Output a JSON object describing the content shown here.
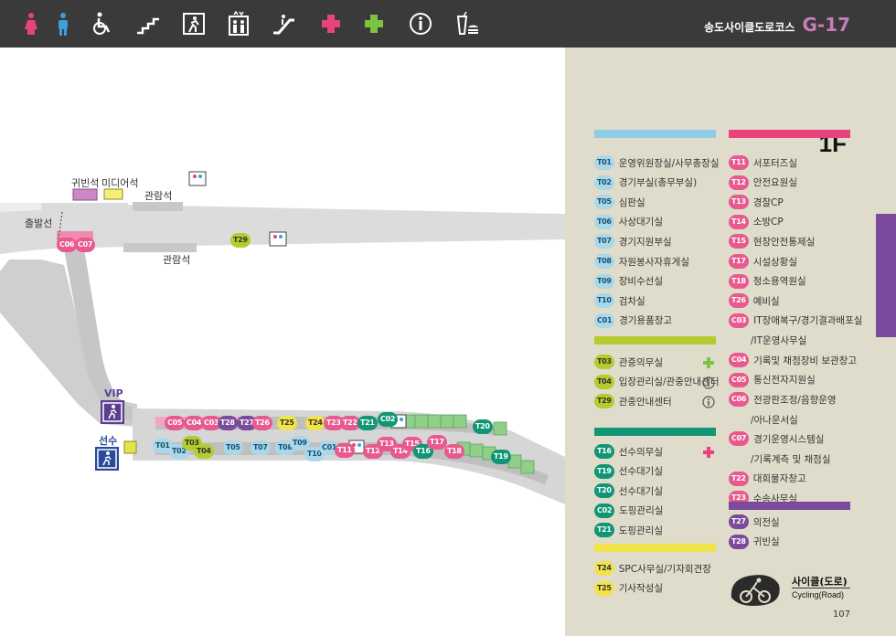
{
  "header": {
    "title": "송도사이클도로코스",
    "code": "G-17",
    "icons": [
      {
        "name": "female-restroom-icon",
        "color": "#e8437d"
      },
      {
        "name": "male-restroom-icon",
        "color": "#3aa0d8"
      },
      {
        "name": "wheelchair-icon",
        "color": "#ffffff"
      },
      {
        "name": "stairs-icon",
        "color": "#ffffff"
      },
      {
        "name": "emergency-exit-icon",
        "color": "#ffffff"
      },
      {
        "name": "elevator-icon",
        "color": "#ffffff"
      },
      {
        "name": "escalator-icon",
        "color": "#ffffff"
      },
      {
        "name": "first-aid-pink-icon",
        "color": "#e8437d"
      },
      {
        "name": "first-aid-green-icon",
        "color": "#7dc243"
      },
      {
        "name": "information-icon",
        "color": "#ffffff"
      },
      {
        "name": "food-drink-icon",
        "color": "#ffffff"
      }
    ]
  },
  "map": {
    "labels": {
      "vip_box": "귀빈석",
      "media_box": "미디어석",
      "stands_top": "관람석",
      "stands_bottom": "관람석",
      "start_line": "출발선",
      "vip": "VIP",
      "athletes": "선수"
    },
    "markers": [
      {
        "code": "C06",
        "color": "pink"
      },
      {
        "code": "C07",
        "color": "pink"
      },
      {
        "code": "T29",
        "color": "lime"
      },
      {
        "code": "C05",
        "color": "pink"
      },
      {
        "code": "C04",
        "color": "pink"
      },
      {
        "code": "C03",
        "color": "pink"
      },
      {
        "code": "T28",
        "color": "purple"
      },
      {
        "code": "T27",
        "color": "purple"
      },
      {
        "code": "T26",
        "color": "pink"
      },
      {
        "code": "T25",
        "color": "yellow"
      },
      {
        "code": "T24",
        "color": "yellow"
      },
      {
        "code": "T23",
        "color": "pink"
      },
      {
        "code": "T22",
        "color": "pink"
      },
      {
        "code": "T21",
        "color": "green"
      },
      {
        "code": "C02",
        "color": "green"
      },
      {
        "code": "T20",
        "color": "green"
      },
      {
        "code": "T01",
        "color": "blue"
      },
      {
        "code": "T02",
        "color": "blue"
      },
      {
        "code": "T03",
        "color": "lime"
      },
      {
        "code": "T04",
        "color": "lime"
      },
      {
        "code": "T05",
        "color": "blue"
      },
      {
        "code": "T07",
        "color": "blue"
      },
      {
        "code": "T08",
        "color": "blue"
      },
      {
        "code": "T09",
        "color": "blue"
      },
      {
        "code": "T10",
        "color": "blue"
      },
      {
        "code": "C01",
        "color": "blue"
      },
      {
        "code": "T11",
        "color": "pink"
      },
      {
        "code": "T12",
        "color": "pink"
      },
      {
        "code": "T13",
        "color": "pink"
      },
      {
        "code": "T14",
        "color": "pink"
      },
      {
        "code": "T15",
        "color": "pink"
      },
      {
        "code": "T16",
        "color": "green"
      },
      {
        "code": "T17",
        "color": "pink"
      },
      {
        "code": "T18",
        "color": "pink"
      },
      {
        "code": "T19",
        "color": "green"
      }
    ]
  },
  "legend": {
    "floor": "1F",
    "colors": {
      "blue": "#8fcde6",
      "pink": "#e8437d",
      "lime": "#b6cc2e",
      "green": "#109675",
      "yellow": "#f1e34a",
      "purple": "#7a4a9c"
    },
    "left_blue": [
      {
        "code": "T01",
        "label": "운영위원장실/사무총장실"
      },
      {
        "code": "T02",
        "label": "경기부실(총무부실)"
      },
      {
        "code": "T05",
        "label": "심판실"
      },
      {
        "code": "T06",
        "label": "사상대기실"
      },
      {
        "code": "T07",
        "label": "경기지원부실"
      },
      {
        "code": "T08",
        "label": "자원봉사자휴게실"
      },
      {
        "code": "T09",
        "label": "장비수선실"
      },
      {
        "code": "T10",
        "label": "검차실"
      },
      {
        "code": "C01",
        "label": "경기용품창고"
      }
    ],
    "left_lime": [
      {
        "code": "T03",
        "label": "관중의무실",
        "icon": "first-aid-green-icon"
      },
      {
        "code": "T04",
        "label": "입장관리실/관중안내센터",
        "icon": "information-icon"
      },
      {
        "code": "T29",
        "label": "관중안내센터",
        "icon": "information-icon"
      }
    ],
    "left_green": [
      {
        "code": "T16",
        "label": "선수의무실",
        "icon": "first-aid-pink-icon"
      },
      {
        "code": "T19",
        "label": "선수대기실"
      },
      {
        "code": "T20",
        "label": "선수대기실"
      },
      {
        "code": "C02",
        "label": "도핑관리실"
      },
      {
        "code": "T21",
        "label": "도핑관리실"
      }
    ],
    "left_yellow": [
      {
        "code": "T24",
        "label": "SPC사무실/기자회견장"
      },
      {
        "code": "T25",
        "label": "기사작성실"
      }
    ],
    "right_pink": [
      {
        "code": "T11",
        "label": "서포터즈실"
      },
      {
        "code": "T12",
        "label": "안전요원실"
      },
      {
        "code": "T13",
        "label": "경찰CP"
      },
      {
        "code": "T14",
        "label": "소방CP"
      },
      {
        "code": "T15",
        "label": "현장안전통제실"
      },
      {
        "code": "T17",
        "label": "시설상황실"
      },
      {
        "code": "T18",
        "label": "청소용역원실"
      },
      {
        "code": "T26",
        "label": "예비실"
      },
      {
        "code": "C03",
        "label": "IT장애복구/경기결과배포실",
        "cont": "/IT운영사무실"
      },
      {
        "code": "C04",
        "label": "기록및 채점장비 보관창고"
      },
      {
        "code": "C05",
        "label": "통신전자지원실"
      },
      {
        "code": "C06",
        "label": "전광판조정/음향운영",
        "cont": "/아나운서실"
      },
      {
        "code": "C07",
        "label": "경기운영시스템실",
        "cont": "/기록계측 및 채점실"
      },
      {
        "code": "T22",
        "label": "대회물자창고"
      },
      {
        "code": "T23",
        "label": "수송사무실"
      }
    ],
    "right_purple": [
      {
        "code": "T27",
        "label": "의전실"
      },
      {
        "code": "T28",
        "label": "귀빈실"
      }
    ]
  },
  "footer": {
    "cycling_kr": "사이클(도로)",
    "cycling_en": "Cycling(Road)",
    "page": "107"
  }
}
